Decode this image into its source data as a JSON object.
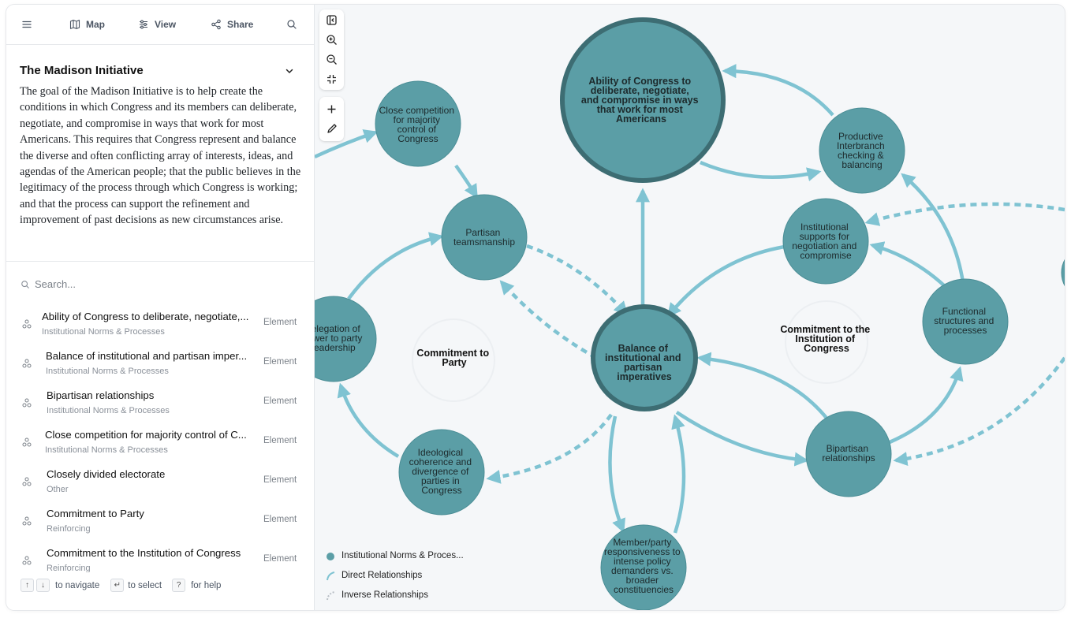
{
  "toolbar": {
    "map_label": "Map",
    "view_label": "View",
    "share_label": "Share"
  },
  "description": {
    "title": "The Madison Initiative",
    "text": "The goal of the Madison Initiative is to help create the conditions in which Congress and its members can deliberate, negotiate, and compromise in ways that work for most Americans. This requires that Congress represent and balance the diverse and often conflicting array of interests, ideas, and agendas of the American people; that the public believes in the legitimacy of the process through which Congress is working; and that the process can support the refinement and improvement of past decisions as new circumstances arise."
  },
  "search": {
    "placeholder": "Search..."
  },
  "elements": [
    {
      "name": "Ability of Congress to deliberate, negotiate,...",
      "category": "Institutional Norms & Processes",
      "type": "Element"
    },
    {
      "name": "Balance of institutional and partisan imper...",
      "category": "Institutional Norms & Processes",
      "type": "Element"
    },
    {
      "name": "Bipartisan relationships",
      "category": "Institutional Norms & Processes",
      "type": "Element"
    },
    {
      "name": "Close competition for majority control of C...",
      "category": "Institutional Norms & Processes",
      "type": "Element"
    },
    {
      "name": "Closely divided electorate",
      "category": "Other",
      "type": "Element"
    },
    {
      "name": "Commitment to Party",
      "category": "Reinforcing",
      "type": "Element"
    },
    {
      "name": "Commitment to the Institution of Congress",
      "category": "Reinforcing",
      "type": "Element"
    }
  ],
  "help": {
    "up_key": "↑",
    "down_key": "↓",
    "navigate_label": "to navigate",
    "enter_key": "↵",
    "select_label": "to select",
    "help_key": "?",
    "help_label": "for help"
  },
  "map": {
    "nodes": {
      "ability": [
        "Ability of Congress to",
        "deliberate, negotiate,",
        "and compromise in ways",
        "that work for most",
        "Americans"
      ],
      "close_competition": [
        "Close competition",
        "for majority",
        "control of",
        "Congress"
      ],
      "productive": [
        "Productive",
        "Interbranch",
        "checking &",
        "balancing"
      ],
      "partisan_team": [
        "Partisan",
        "teamsmanship"
      ],
      "institutional_supports": [
        "Institutional",
        "supports for",
        "negotiation and",
        "compromise"
      ],
      "delegation": [
        "Delegation of",
        "power to party",
        "leadership"
      ],
      "balance": [
        "Balance of",
        "institutional and",
        "partisan",
        "imperatives"
      ],
      "functional": [
        "Functional",
        "structures and",
        "processes"
      ],
      "ideological": [
        "Ideological",
        "coherence and",
        "divergence of",
        "parties in",
        "Congress"
      ],
      "bipartisan": [
        "Bipartisan",
        "relationships"
      ],
      "member_party": [
        "Member/party",
        "responsiveness to",
        "intense policy",
        "demanders vs.",
        "broader",
        "constituencies"
      ]
    },
    "loops": {
      "party": [
        "Commitment to",
        "Party"
      ],
      "institution": [
        "Commitment to the",
        "Institution of",
        "Congress"
      ]
    },
    "colors": {
      "node_fill": "#5b9ea6",
      "node_stroke": "#4a8d95",
      "key_ring": "#3d6d73",
      "edge": "#7fc3d2",
      "background": "#f5f7f9"
    }
  },
  "legend": {
    "items": [
      {
        "label": "Institutional Norms & Proces...",
        "icon": "circle-icon"
      },
      {
        "label": "Direct Relationships",
        "icon": "arc-icon"
      },
      {
        "label": "Inverse Relationships",
        "icon": "dotted-arc-icon"
      }
    ]
  }
}
